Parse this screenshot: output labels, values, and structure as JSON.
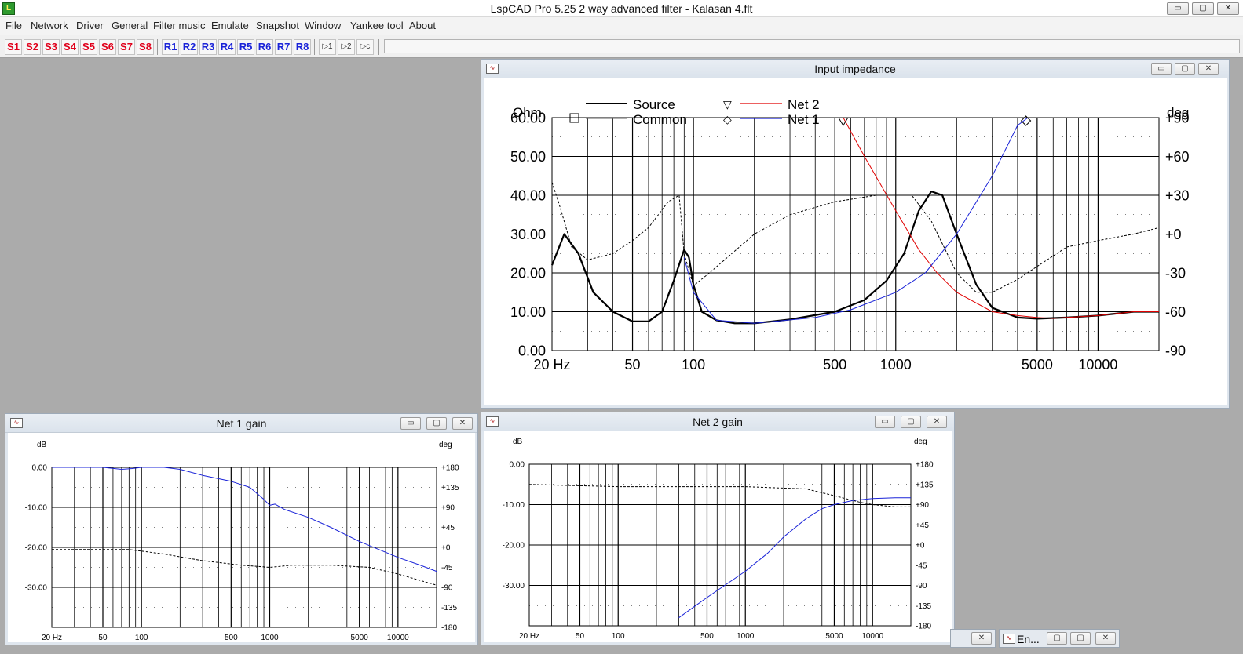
{
  "window": {
    "title": "LspCAD Pro 5.25 2 way advanced filter - Kalasan 4.flt",
    "icon": "lspcad-app-icon",
    "controls": {
      "minimize": "▭",
      "restore": "▢",
      "close": "✕"
    }
  },
  "menu": [
    "File",
    "Network",
    "Driver",
    "General",
    "Filter music",
    "Emulate",
    "Snapshot",
    "Window",
    "Yankee tool",
    "About"
  ],
  "toolbar": {
    "s_buttons": [
      "S1",
      "S2",
      "S3",
      "S4",
      "S5",
      "S6",
      "S7",
      "S8"
    ],
    "r_buttons": [
      "R1",
      "R2",
      "R3",
      "R4",
      "R5",
      "R6",
      "R7",
      "R8"
    ],
    "icons": [
      "network-1-icon",
      "network-2-icon",
      "network-c-icon"
    ],
    "colors": {
      "s": "#e0001b",
      "r": "#1a23d8"
    }
  },
  "impedance_window": {
    "title": "Input impedance",
    "left_unit": "Ohm",
    "right_unit": "deg",
    "legend": {
      "source": "Source",
      "common": "Common",
      "net2": "Net 2",
      "net1": "Net 1",
      "net2_marker": "▽",
      "net1_marker": "◇",
      "common_marker": "□"
    },
    "y_ticks": [
      "60.00",
      "50.00",
      "40.00",
      "30.00",
      "20.00",
      "10.00",
      "0.00"
    ],
    "phase_ticks": [
      "+90",
      "+60",
      "+30",
      "+0",
      "-30",
      "-60",
      "-90"
    ],
    "x_ticks": [
      "20 Hz",
      "50",
      "100",
      "500",
      "1000",
      "5000",
      "10000"
    ]
  },
  "net1_window": {
    "title": "Net 1 gain",
    "left_unit": "dB",
    "right_unit": "deg",
    "y_ticks": [
      "0.00",
      "-10.00",
      "-20.00",
      "-30.00"
    ],
    "phase_ticks": [
      "+180",
      "+135",
      "+90",
      "+45",
      "+0",
      "-45",
      "-90",
      "-135",
      "-180"
    ],
    "x_ticks": [
      "20 Hz",
      "50",
      "100",
      "500",
      "1000",
      "5000",
      "10000"
    ]
  },
  "net2_window": {
    "title": "Net 2 gain",
    "left_unit": "dB",
    "right_unit": "deg",
    "y_ticks": [
      "0.00",
      "-10.00",
      "-20.00",
      "-30.00"
    ],
    "phase_ticks": [
      "+180",
      "+135",
      "+90",
      "+45",
      "+0",
      "-45",
      "-90",
      "-135",
      "-180"
    ],
    "x_ticks": [
      "20 Hz",
      "50",
      "100",
      "500",
      "1000",
      "5000",
      "10000"
    ]
  },
  "taskbar": {
    "en_label": "En..."
  },
  "chart_data": [
    {
      "type": "line",
      "title": "Input impedance",
      "xscale": "log",
      "xlim": [
        20,
        20000
      ],
      "ylabel": "Ohm",
      "ylim": [
        0,
        60
      ],
      "y2label": "deg",
      "y2lim": [
        -90,
        90
      ],
      "grid": true,
      "series": [
        {
          "name": "Source",
          "axis": "y",
          "color": "#000000",
          "style": "solid-bold",
          "points": [
            [
              20,
              22
            ],
            [
              23,
              30
            ],
            [
              27,
              25
            ],
            [
              32,
              15
            ],
            [
              40,
              10
            ],
            [
              50,
              7.5
            ],
            [
              60,
              7.5
            ],
            [
              70,
              10
            ],
            [
              80,
              18
            ],
            [
              90,
              26
            ],
            [
              95,
              24
            ],
            [
              100,
              17
            ],
            [
              110,
              10
            ],
            [
              130,
              7.8
            ],
            [
              160,
              7
            ],
            [
              200,
              7
            ],
            [
              300,
              8
            ],
            [
              500,
              10
            ],
            [
              700,
              13
            ],
            [
              900,
              18
            ],
            [
              1100,
              25
            ],
            [
              1300,
              36
            ],
            [
              1500,
              41
            ],
            [
              1700,
              40
            ],
            [
              2000,
              30
            ],
            [
              2500,
              17
            ],
            [
              3000,
              11
            ],
            [
              4000,
              8.5
            ],
            [
              5000,
              8.2
            ],
            [
              7000,
              8.5
            ],
            [
              10000,
              9
            ],
            [
              15000,
              10
            ],
            [
              20000,
              10
            ]
          ]
        },
        {
          "name": "Source phase",
          "axis": "y2",
          "color": "#000000",
          "style": "dashed",
          "points": [
            [
              20,
              40
            ],
            [
              22,
              20
            ],
            [
              25,
              -10
            ],
            [
              30,
              -20
            ],
            [
              40,
              -15
            ],
            [
              50,
              -5
            ],
            [
              60,
              5
            ],
            [
              75,
              25
            ],
            [
              85,
              30
            ],
            [
              90,
              -15
            ],
            [
              100,
              -40
            ],
            [
              120,
              -30
            ],
            [
              200,
              0
            ],
            [
              300,
              15
            ],
            [
              500,
              25
            ],
            [
              800,
              30
            ],
            [
              1000,
              30
            ],
            [
              1200,
              30
            ],
            [
              1500,
              10
            ],
            [
              2000,
              -30
            ],
            [
              2500,
              -45
            ],
            [
              3000,
              -45
            ],
            [
              4000,
              -35
            ],
            [
              5000,
              -25
            ],
            [
              7000,
              -10
            ],
            [
              10000,
              -5
            ],
            [
              15000,
              0
            ],
            [
              20000,
              5
            ]
          ]
        },
        {
          "name": "Net 2",
          "axis": "y",
          "color": "#e00000",
          "style": "solid",
          "points": [
            [
              550,
              60
            ],
            [
              700,
              50
            ],
            [
              1000,
              36
            ],
            [
              1300,
              26
            ],
            [
              1600,
              20
            ],
            [
              2000,
              15
            ],
            [
              3000,
              10
            ],
            [
              4000,
              9
            ],
            [
              5000,
              8.5
            ],
            [
              6000,
              8.3
            ],
            [
              7000,
              8.5
            ],
            [
              10000,
              9
            ],
            [
              15000,
              10
            ],
            [
              20000,
              10
            ]
          ]
        },
        {
          "name": "Net 1",
          "axis": "y",
          "color": "#1a23d8",
          "style": "solid",
          "points": [
            [
              90,
              24
            ],
            [
              100,
              15
            ],
            [
              130,
              7.8
            ],
            [
              200,
              7
            ],
            [
              400,
              8.5
            ],
            [
              600,
              10.5
            ],
            [
              1000,
              15
            ],
            [
              1400,
              20
            ],
            [
              2000,
              30
            ],
            [
              3000,
              45
            ],
            [
              4000,
              58
            ],
            [
              4500,
              62
            ]
          ]
        }
      ]
    },
    {
      "type": "line",
      "title": "Net 1 gain",
      "xscale": "log",
      "xlim": [
        20,
        20000
      ],
      "ylabel": "dB",
      "ylim": [
        -40,
        0
      ],
      "y2label": "deg",
      "y2lim": [
        -180,
        180
      ],
      "grid": true,
      "series": [
        {
          "name": "Net 1 gain",
          "axis": "y",
          "color": "#1a23d8",
          "style": "solid",
          "points": [
            [
              20,
              0
            ],
            [
              50,
              0
            ],
            [
              70,
              -0.5
            ],
            [
              85,
              -0.3
            ],
            [
              100,
              0.5
            ],
            [
              150,
              0.3
            ],
            [
              200,
              -0.5
            ],
            [
              300,
              -2
            ],
            [
              500,
              -3.5
            ],
            [
              700,
              -5
            ],
            [
              900,
              -8
            ],
            [
              1000,
              -9.5
            ],
            [
              1100,
              -9.2
            ],
            [
              1300,
              -10.5
            ],
            [
              2000,
              -12.5
            ],
            [
              3000,
              -15
            ],
            [
              5000,
              -18.5
            ],
            [
              10000,
              -22.5
            ],
            [
              15000,
              -24.5
            ],
            [
              20000,
              -26
            ]
          ]
        },
        {
          "name": "Net 1 phase",
          "axis": "y2",
          "color": "#000000",
          "style": "dashed",
          "points": [
            [
              20,
              -5
            ],
            [
              50,
              -5
            ],
            [
              80,
              -5
            ],
            [
              150,
              -15
            ],
            [
              300,
              -30
            ],
            [
              600,
              -40
            ],
            [
              1000,
              -45
            ],
            [
              1500,
              -40
            ],
            [
              3000,
              -40
            ],
            [
              6000,
              -45
            ],
            [
              10000,
              -60
            ],
            [
              20000,
              -85
            ]
          ]
        }
      ]
    },
    {
      "type": "line",
      "title": "Net 2 gain",
      "xscale": "log",
      "xlim": [
        20,
        20000
      ],
      "ylabel": "dB",
      "ylim": [
        -40,
        0
      ],
      "y2label": "deg",
      "y2lim": [
        -180,
        180
      ],
      "grid": true,
      "series": [
        {
          "name": "Net 2 gain",
          "axis": "y",
          "color": "#1a23d8",
          "style": "solid",
          "points": [
            [
              300,
              -38
            ],
            [
              500,
              -33
            ],
            [
              1000,
              -26.5
            ],
            [
              1500,
              -22
            ],
            [
              2000,
              -18
            ],
            [
              3000,
              -13.5
            ],
            [
              4000,
              -11
            ],
            [
              5000,
              -10
            ],
            [
              7000,
              -9
            ],
            [
              10000,
              -8.5
            ],
            [
              15000,
              -8.3
            ],
            [
              20000,
              -8.3
            ]
          ]
        },
        {
          "name": "Net 2 phase",
          "axis": "y2",
          "color": "#000000",
          "style": "dashed",
          "points": [
            [
              20,
              135
            ],
            [
              100,
              130
            ],
            [
              300,
              130
            ],
            [
              1000,
              130
            ],
            [
              3000,
              125
            ],
            [
              5000,
              110
            ],
            [
              8000,
              95
            ],
            [
              10000,
              90
            ],
            [
              15000,
              85
            ],
            [
              20000,
              85
            ]
          ]
        }
      ]
    }
  ]
}
